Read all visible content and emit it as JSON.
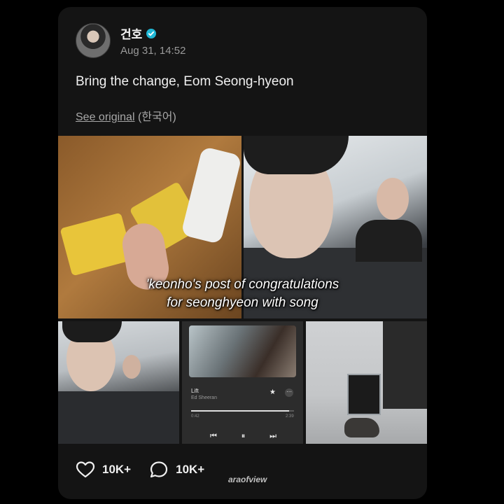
{
  "post": {
    "username": "건호",
    "verified_color": "#20b8d6",
    "timestamp": "Aug 31, 14:52",
    "text": "Bring the change, Eom Seong-hyeon",
    "see_original_label": "See original",
    "language_label": "(한국어)"
  },
  "media": {
    "caption_line1": "'keonho's post of congratulations",
    "caption_line2": "for seonghyeon with song",
    "song_title": "Lift",
    "song_artist": "Ed Sheeran",
    "song_progress": 0.95,
    "time_elapsed": "0:42",
    "time_total": "2:39"
  },
  "actions": {
    "like_count": "10K+",
    "comment_count": "10K+"
  },
  "watermark": "araofview",
  "icons": {
    "like": "heart-icon",
    "comment": "comment-icon",
    "verified": "verified-badge-icon",
    "star": "star-icon",
    "more": "more-icon"
  }
}
